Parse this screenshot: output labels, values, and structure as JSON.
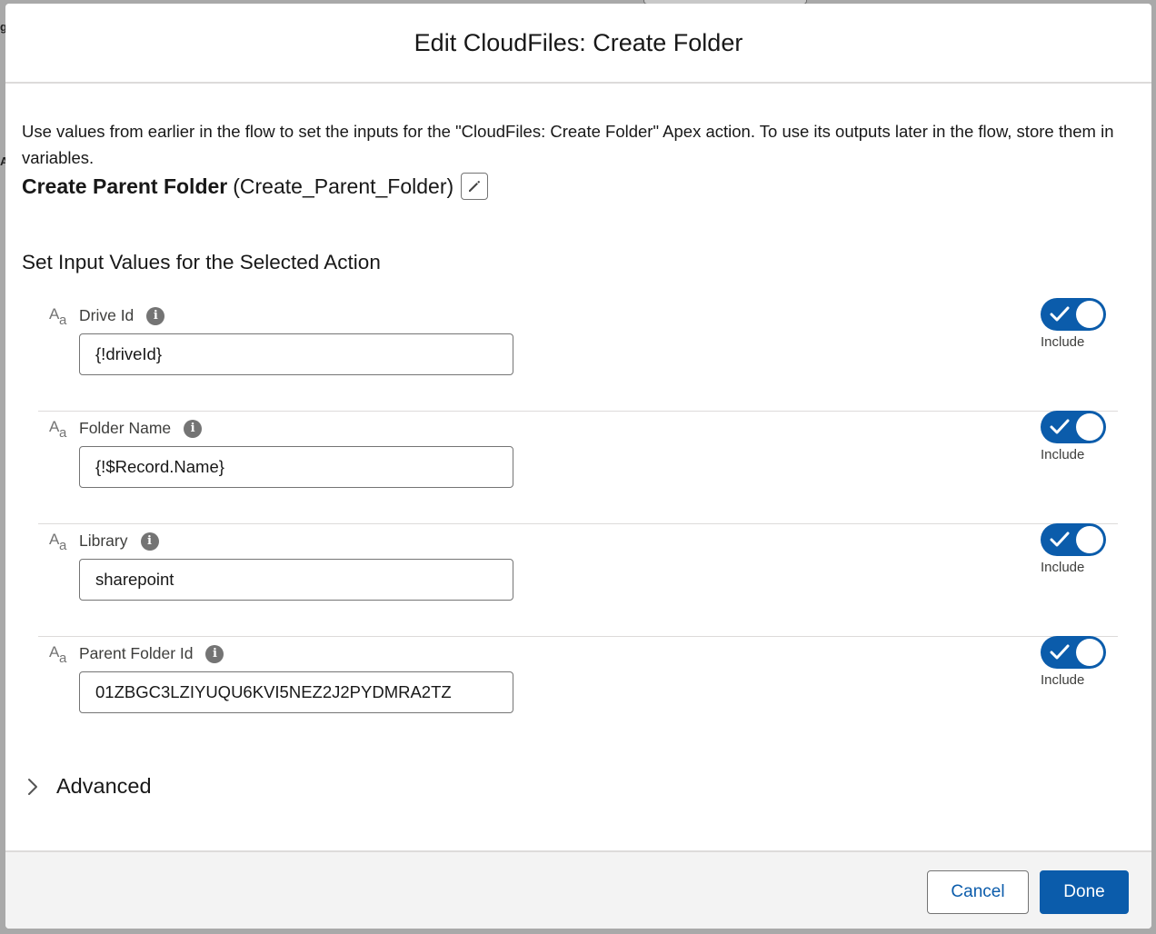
{
  "modal": {
    "title": "Edit CloudFiles: Create Folder"
  },
  "intro": "Use values from earlier in the flow to set the inputs for the \"CloudFiles: Create Folder\" Apex action. To use its outputs later in the flow, store them in variables.",
  "action": {
    "label": "Create Parent Folder",
    "api_name": "(Create_Parent_Folder)"
  },
  "section_heading": "Set Input Values for the Selected Action",
  "type_icon": {
    "big": "A",
    "small": "a"
  },
  "info_glyph": "i",
  "params": [
    {
      "label": "Drive Id",
      "value": "{!driveId}",
      "include_label": "Include",
      "include": true
    },
    {
      "label": "Folder Name",
      "value": "{!$Record.Name}",
      "include_label": "Include",
      "include": true
    },
    {
      "label": "Library",
      "value": "sharepoint",
      "include_label": "Include",
      "include": true
    },
    {
      "label": "Parent Folder Id",
      "value": "01ZBGC3LZIYUQU6KVI5NEZ2J2PYDMRA2TZ",
      "include_label": "Include",
      "include": true
    }
  ],
  "advanced": {
    "label": "Advanced"
  },
  "footer": {
    "cancel_label": "Cancel",
    "done_label": "Done"
  },
  "background": {
    "frag1": "g",
    "frag2": "A"
  },
  "colors": {
    "brand": "#0b5cab",
    "footer_bg": "#f3f3f3",
    "border": "#dddbda"
  },
  "icons": [
    "pencil-icon",
    "info-icon",
    "text-type-icon",
    "check-icon",
    "chevron-right-icon"
  ]
}
